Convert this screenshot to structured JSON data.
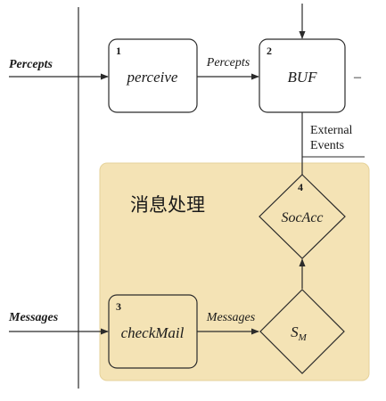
{
  "region": {
    "label": "消息处理",
    "fill": "#f4e3b5",
    "border": "#e6d29a"
  },
  "stroke_color": "#2b2b2b",
  "inputs": {
    "percepts": "Percepts",
    "messages": "Messages"
  },
  "nodes": {
    "perceive": {
      "number": "1",
      "label": "perceive"
    },
    "buf": {
      "number": "2",
      "label": "BUF",
      "trailing_mark": "–"
    },
    "check_mail": {
      "number": "3",
      "label": "checkMail"
    },
    "soc_acc": {
      "number": "4",
      "label": "SocAcc"
    },
    "s_m": {
      "label": "S",
      "subscript": "M"
    }
  },
  "edges": {
    "perceive_to_buf": "Percepts",
    "check_mail_to_s_m": "Messages",
    "soc_acc_to_buf": [
      "External",
      "Events"
    ]
  }
}
